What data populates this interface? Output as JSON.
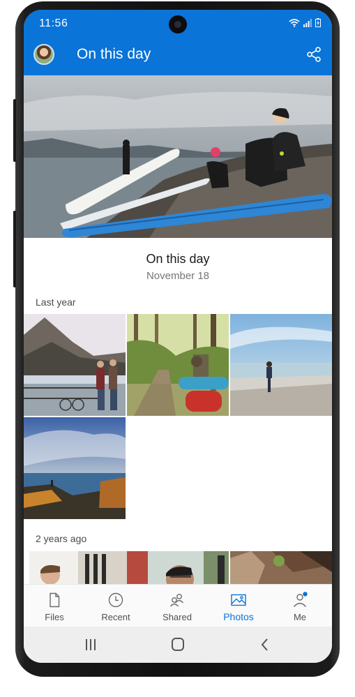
{
  "status_bar": {
    "time": "11:56"
  },
  "app_bar": {
    "title": "On this day"
  },
  "memory": {
    "title": "On this day",
    "date": "November 18"
  },
  "sections": [
    {
      "label": "Last year"
    },
    {
      "label": "2 years ago"
    }
  ],
  "tabs": [
    {
      "label": "Files",
      "icon": "file-icon"
    },
    {
      "label": "Recent",
      "icon": "clock-icon"
    },
    {
      "label": "Shared",
      "icon": "people-icon"
    },
    {
      "label": "Photos",
      "icon": "photo-icon",
      "active": true
    },
    {
      "label": "Me",
      "icon": "person-icon",
      "badge": true
    }
  ],
  "system_nav": [
    "recents-icon",
    "home-icon",
    "back-icon"
  ],
  "colors": {
    "accent": "#0a74d8",
    "tab_inactive": "#505050",
    "badge": "#0a74d8"
  }
}
